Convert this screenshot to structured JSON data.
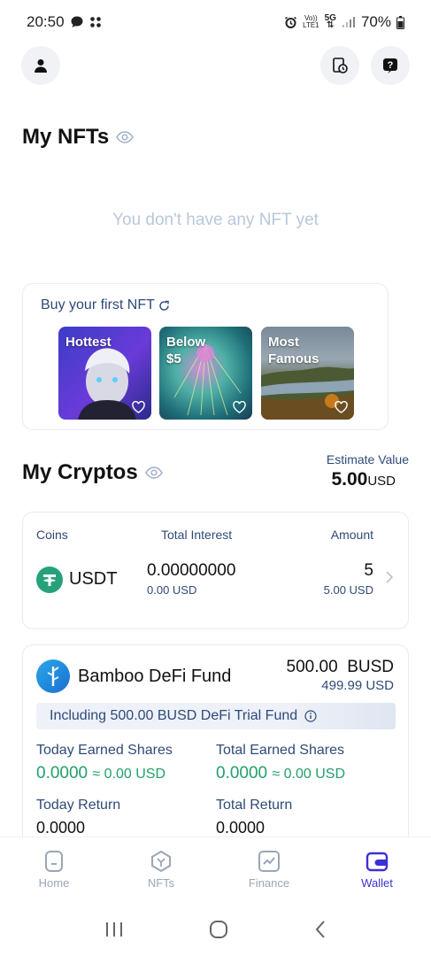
{
  "status_bar": {
    "time": "20:50",
    "battery": "70%",
    "net_top": "Vo))",
    "net_bottom": "LTE1",
    "signal": "5G"
  },
  "nfts": {
    "title": "My NFTs",
    "empty_text": "You don't have any NFT yet",
    "buy_title": "Buy your first NFT",
    "thumbs": [
      {
        "label_line1": "Hottest",
        "label_line2": ""
      },
      {
        "label_line1": "Below",
        "label_line2": "$5"
      },
      {
        "label_line1": "Most",
        "label_line2": "Famous"
      }
    ]
  },
  "cryptos": {
    "title": "My Cryptos",
    "estimate_label": "Estimate Value",
    "estimate_value": "5.00",
    "estimate_unit": "USD",
    "headers": {
      "coins": "Coins",
      "interest": "Total Interest",
      "amount": "Amount"
    },
    "coin": {
      "name": "USDT",
      "interest": "0.00000000",
      "interest_usd": "0.00 USD",
      "amount": "5",
      "amount_usd": "5.00 USD"
    }
  },
  "fund": {
    "name": "Bamboo DeFi Fund",
    "amount": "500.00  BUSD",
    "amount_usd": "499.99 USD",
    "trial_text": "Including 500.00 BUSD DeFi Trial Fund",
    "today_earned_label": "Today Earned Shares",
    "today_earned_value": "0.0000",
    "today_earned_usd": "≈ 0.00 USD",
    "total_earned_label": "Total Earned Shares",
    "total_earned_value": "0.0000",
    "total_earned_usd": "≈ 0.00 USD",
    "today_return_label": "Today Return",
    "today_return_value": "0.0000",
    "total_return_label": "Total Return",
    "total_return_value": "0.0000"
  },
  "tabs": [
    {
      "label": "Home"
    },
    {
      "label": "NFTs"
    },
    {
      "label": "Finance"
    },
    {
      "label": "Wallet"
    }
  ],
  "colors": {
    "accent": "#3b2fd6",
    "label": "#2f4a78",
    "green": "#22a06b",
    "muted": "#b9c8da"
  }
}
